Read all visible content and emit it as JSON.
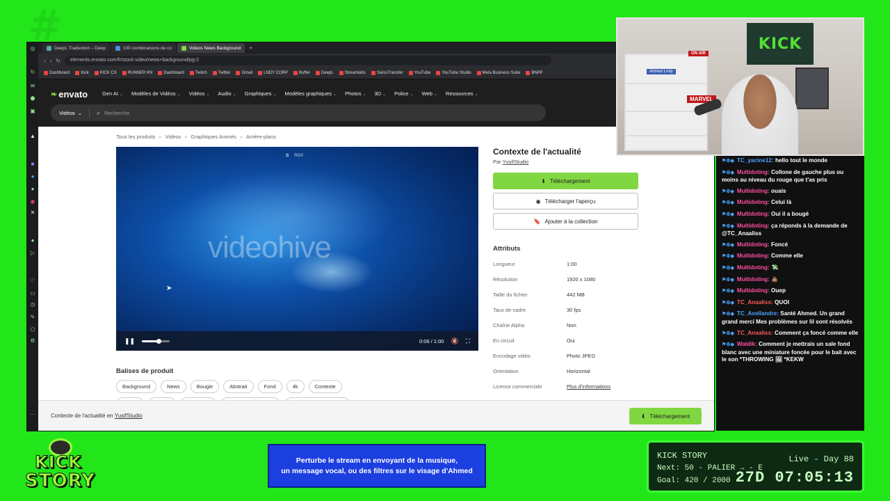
{
  "browser": {
    "tabs": [
      {
        "label": "DeepL Traduction – Deep",
        "active": false
      },
      {
        "label": "100 combinaisons de co",
        "active": false
      },
      {
        "label": "Videos News Background",
        "active": true
      }
    ],
    "url": "elements.envato.com/fr/stock-video/news+background/pg-2",
    "bookmarks": [
      "Dashboard",
      "Kick",
      "KICK CX",
      "RUNNER KN",
      "Dashboard",
      "Twitch",
      "Twitter",
      "Gmail",
      "LNDY CORP",
      "Buffer",
      "DeepL",
      "Streamlabs",
      "SwissTransfer",
      "YouTube",
      "YouTube Studio",
      "Meta Business Suite",
      "BNPP"
    ]
  },
  "envato": {
    "logo": "envato",
    "menu": [
      "Gen AI",
      "Modèles de Vidéos",
      "Vidéos",
      "Audio",
      "Graphiques",
      "Modèles graphiques",
      "Photos",
      "3D",
      "Police",
      "Web",
      "Ressources"
    ],
    "search": {
      "category": "Vidéos",
      "placeholder": "Recherche"
    }
  },
  "breadcrumb": [
    "Tous les produits",
    "Vidéos",
    "Graphiques Animés",
    "Arrière-plans"
  ],
  "player": {
    "watermark": "videohive",
    "badge": "RGX",
    "time": "0:06 / 1:00",
    "progress": 0.6
  },
  "tags_title": "Balises de produit",
  "tags": [
    "Background",
    "News",
    "Bougie",
    "Abstrait",
    "Fond",
    "4k",
    "Contexte"
  ],
  "product": {
    "title": "Contexte de l'actualité",
    "by": "Par",
    "author": "YusifStudio",
    "download_label": "Téléchargement",
    "preview_label": "Télécharger l'aperçu",
    "collection_label": "Ajouter à la collection"
  },
  "attributes": {
    "title": "Attributs",
    "rows": [
      {
        "key": "Longueur",
        "value": "1:00"
      },
      {
        "key": "Résolution",
        "value": "1920 x 1080"
      },
      {
        "key": "Taille du fichier",
        "value": "442 MB"
      },
      {
        "key": "Taux de cadre",
        "value": "30 fps"
      },
      {
        "key": "Chaîne Alpha",
        "value": "Non"
      },
      {
        "key": "En circuit",
        "value": "Oui"
      },
      {
        "key": "Encodage vidéo",
        "value": "Photo JPEG"
      },
      {
        "key": "Orientation",
        "value": "Horizontal"
      },
      {
        "key": "Licence commerciale",
        "value": "Plus d'informations"
      }
    ]
  },
  "footer": {
    "text": "Contexte de l'actualité en",
    "author": "YusifStudio",
    "download_label": "Téléchargement"
  },
  "webcam": {
    "kick_sign": "KICK",
    "on_air": "ON AIR",
    "name_sign": "Ahmed Lndy",
    "marvel": "MARVEL"
  },
  "chat": [
    {
      "user": "TC_yacine12:",
      "color": "#4aa3ff",
      "text": "hello tout le monde"
    },
    {
      "user": "Multidoting:",
      "color": "#ff4fa3",
      "text": "Collone de gauche plus ou moins au niveau du rouge que t'as pris"
    },
    {
      "user": "Multidoting:",
      "color": "#ff4fa3",
      "text": "ouais"
    },
    {
      "user": "Multidoting:",
      "color": "#ff4fa3",
      "text": "Celui là"
    },
    {
      "user": "Multidoting:",
      "color": "#ff4fa3",
      "text": "Oui il a bougé"
    },
    {
      "user": "Multidoting:",
      "color": "#ff4fa3",
      "text": "ça réponds à la demande de @TC_Anaaliss"
    },
    {
      "user": "Multidoting:",
      "color": "#ff4fa3",
      "text": "Foncé"
    },
    {
      "user": "Multidoting:",
      "color": "#ff4fa3",
      "text": "Comme elle"
    },
    {
      "user": "Multidoting:",
      "color": "#ff4fa3",
      "text": "💸"
    },
    {
      "user": "Multidoting:",
      "color": "#ff4fa3",
      "text": "💩"
    },
    {
      "user": "Multidoting:",
      "color": "#ff4fa3",
      "text": "Ouep"
    },
    {
      "user": "TC_Anaaliss:",
      "color": "#ff5a5a",
      "text": "QUOI"
    },
    {
      "user": "TC_Axellandre:",
      "color": "#4aa3ff",
      "text": "Santé Ahmed. Un grand grand merci Mes problèmes sur lil sont résolvés"
    },
    {
      "user": "TC_Anaaliss:",
      "color": "#ff5a5a",
      "text": "Comment ça foncé comme elle"
    },
    {
      "user": "Waldik:",
      "color": "#ff4fa3",
      "text": "Comment je mettrais un sale fond blanc avec une miniature foncée pour le bait avec le son *THROWING 🖼 *KEKW"
    }
  ],
  "overlay": {
    "logo_top": "KICK",
    "logo_bottom": "STORY",
    "banner_line1": "Perturbe le stream en envoyant de la musique,",
    "banner_line2": "un message vocal, ou des filtres sur le visage d'Ahmed",
    "timer": {
      "title": "KICK STORY",
      "live": "Live - Day 88",
      "next": "Next: 50 - PALIER → - E",
      "goal": "Goal: 420 / 2000",
      "countdown": "27D 07:05:13"
    }
  },
  "colors": {
    "brand_green": "#81d742",
    "stream_green": "#22e61a",
    "banner_blue": "#1c3fe0"
  }
}
